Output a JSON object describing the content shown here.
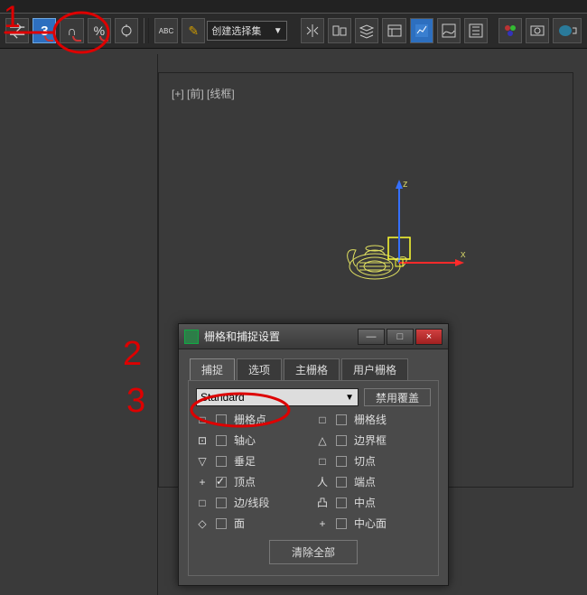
{
  "toolbar": {
    "snap3_label": "3",
    "angle_label": "°",
    "percent_label": "%",
    "selection_set_label": "创建选择集"
  },
  "viewport": {
    "label": "[+] [前] [线框]",
    "axis_x": "x",
    "axis_z": "z"
  },
  "dialog": {
    "title": "栅格和捕捉设置",
    "win_min": "—",
    "win_max": "□",
    "win_close": "×",
    "tabs": {
      "snap": "捕捉",
      "options": "选项",
      "home_grid": "主栅格",
      "user_grid": "用户栅格"
    },
    "override_set": "Standard",
    "disable_override": "禁用覆盖",
    "opts": [
      {
        "shape": "□",
        "checked": false,
        "label": "栅格点"
      },
      {
        "shape": "□",
        "checked": false,
        "label": "栅格线"
      },
      {
        "shape": "⊡",
        "checked": false,
        "label": "轴心"
      },
      {
        "shape": "△",
        "checked": false,
        "label": "边界框"
      },
      {
        "shape": "▽",
        "checked": false,
        "label": "垂足"
      },
      {
        "shape": "□",
        "checked": false,
        "label": "切点"
      },
      {
        "shape": "+",
        "checked": true,
        "label": "顶点"
      },
      {
        "shape": "人",
        "checked": false,
        "label": "端点"
      },
      {
        "shape": "□",
        "checked": false,
        "label": "边/线段"
      },
      {
        "shape": "凸",
        "checked": false,
        "label": "中点"
      },
      {
        "shape": "◇",
        "checked": false,
        "label": "面"
      },
      {
        "shape": "+",
        "checked": false,
        "label": "中心面"
      }
    ],
    "clear_all": "清除全部"
  },
  "annotations": {
    "one": "1",
    "two": "2",
    "three": "3"
  }
}
